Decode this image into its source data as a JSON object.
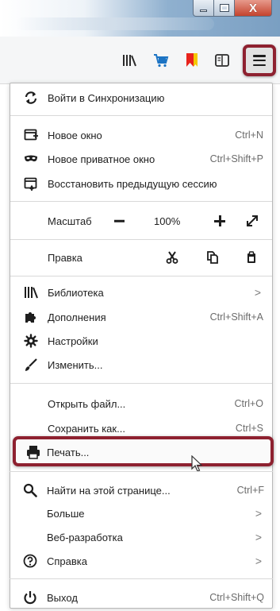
{
  "titlebar": {
    "minimize_icon": "minimize-icon",
    "maximize_icon": "maximize-icon",
    "close_label": "X"
  },
  "toolbar": {
    "icons": [
      "library-icon",
      "cart-icon",
      "bookmark-icon",
      "reader-view-icon",
      "hamburger-menu-icon"
    ]
  },
  "menu": {
    "sync": {
      "label": "Войти в Синхронизацию",
      "icon": "sync-icon"
    },
    "new_window": {
      "label": "Новое окно",
      "shortcut": "Ctrl+N",
      "icon": "new-window-icon"
    },
    "new_private": {
      "label": "Новое приватное окно",
      "shortcut": "Ctrl+Shift+P",
      "icon": "private-mask-icon"
    },
    "restore_session": {
      "label": "Восстановить предыдущую сессию",
      "icon": "restore-session-icon"
    },
    "zoom": {
      "label": "Масштаб",
      "minus": "−",
      "value": "100%",
      "plus": "+"
    },
    "edit": {
      "label": "Правка",
      "cut_icon": "scissors-icon",
      "copy_icon": "copy-icon",
      "paste_icon": "paste-icon"
    },
    "library": {
      "label": "Библиотека",
      "icon": "library-icon",
      "chevron": ">"
    },
    "addons": {
      "label": "Дополнения",
      "shortcut": "Ctrl+Shift+A",
      "icon": "puzzle-icon"
    },
    "settings": {
      "label": "Настройки",
      "icon": "gear-icon"
    },
    "customize": {
      "label": "Изменить...",
      "icon": "paintbrush-icon"
    },
    "open_file": {
      "label": "Открыть файл...",
      "shortcut": "Ctrl+O"
    },
    "save_as": {
      "label": "Сохранить как...",
      "shortcut": "Ctrl+S"
    },
    "print": {
      "label": "Печать...",
      "icon": "printer-icon"
    },
    "find": {
      "label": "Найти на этой странице...",
      "shortcut": "Ctrl+F",
      "icon": "search-icon"
    },
    "more": {
      "label": "Больше",
      "chevron": ">"
    },
    "web_dev": {
      "label": "Веб-разработка",
      "chevron": ">"
    },
    "help": {
      "label": "Справка",
      "icon": "help-icon",
      "chevron": ">"
    },
    "exit": {
      "label": "Выход",
      "shortcut": "Ctrl+Shift+Q",
      "icon": "power-icon"
    }
  },
  "colors": {
    "highlight_border": "#8e2130",
    "bookmark_red": "#e8231c",
    "bookmark_yellow": "#f5c800",
    "cart_blue": "#1c74c4"
  }
}
